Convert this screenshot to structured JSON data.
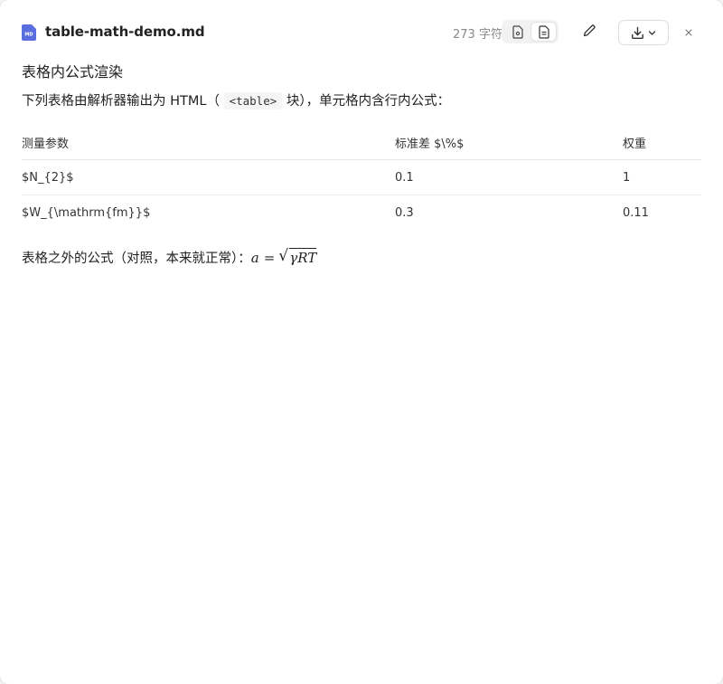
{
  "header": {
    "file_name": "table-math-demo.md",
    "char_count": "273 字符",
    "file_badge": "MD"
  },
  "doc": {
    "heading": "表格内公式渲染",
    "intro_before": "下列表格由解析器输出为 HTML（",
    "intro_code": "<table>",
    "intro_after": "块），单元格内含行内公式：",
    "table": {
      "headers": [
        "测量参数",
        "标准差 $\\%$",
        "权重"
      ],
      "rows": [
        [
          "$N_{2}$",
          "0.1",
          "1"
        ],
        [
          "$W_{\\mathrm{fm}}$",
          "0.3",
          "0.11"
        ]
      ]
    },
    "footer_text": "表格之外的公式（对照，本来就正常）：",
    "formula": {
      "lhs": "a",
      "op": "=",
      "radicand": "γRT"
    }
  },
  "icons": {
    "file": "markdown-file-icon",
    "preview": "preview-doc-icon",
    "source": "source-doc-icon",
    "edit": "pencil-icon",
    "download": "download-icon",
    "chevron": "chevron-down-icon",
    "close": "close-icon"
  },
  "colors": {
    "file_icon": "#5b6ee0",
    "muted_text": "#8a8a8a"
  }
}
